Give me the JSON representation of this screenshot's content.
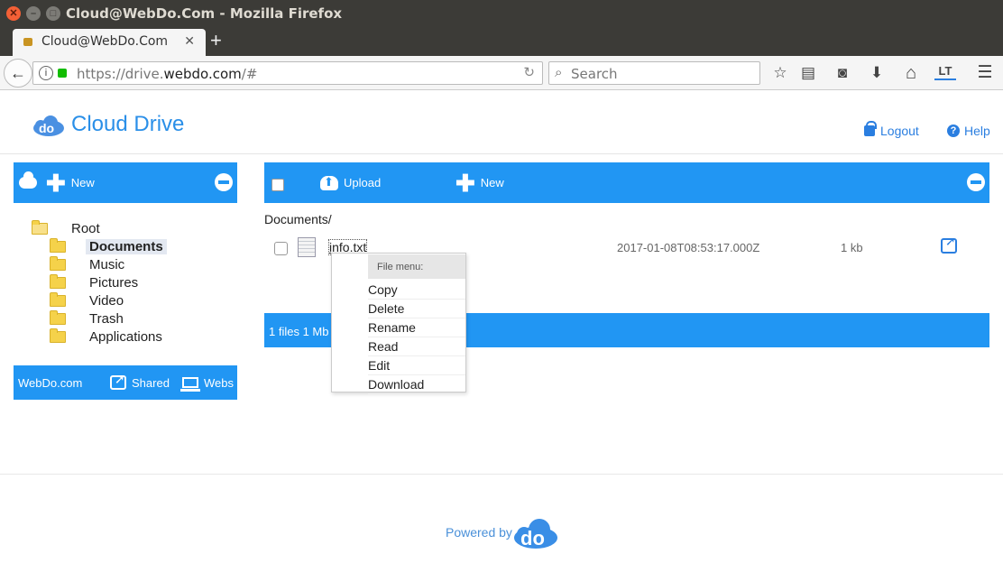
{
  "window": {
    "title": "Cloud@WebDo.Com - Mozilla Firefox",
    "close_glyph": "✕",
    "min_glyph": "–",
    "max_glyph": "□"
  },
  "tab": {
    "title": "Cloud@WebDo.Com",
    "close_glyph": "✕",
    "new_tab_glyph": "+"
  },
  "navbar": {
    "back_glyph": "←",
    "url_prefix": "https://drive.",
    "url_domain": "webdo.com",
    "url_suffix": "/#",
    "reload_glyph": "↻",
    "search_placeholder": "Search",
    "search_glyph": "⌕",
    "toolbar_icons": [
      "star-icon",
      "reading-list-icon",
      "pocket-icon",
      "download-icon",
      "home-icon",
      "languagetool-icon",
      "menu-icon"
    ],
    "star_glyph": "☆",
    "reader_glyph": "▤",
    "pocket_glyph": "◙",
    "download_glyph": "⬇",
    "home_glyph": "⌂",
    "lt_label": "LT",
    "menu_glyph": "☰"
  },
  "header": {
    "brand": "Cloud Drive",
    "logout": "Logout",
    "help": "Help",
    "help_glyph": "?",
    "brand_color": "#2a8fe8"
  },
  "left_panel": {
    "new_label": "New",
    "plus_glyph": "✚",
    "tree": [
      {
        "label": "Root",
        "level": 0,
        "open": true,
        "selected": false
      },
      {
        "label": "Documents",
        "level": 1,
        "open": false,
        "selected": true
      },
      {
        "label": "Music",
        "level": 1,
        "open": false,
        "selected": false
      },
      {
        "label": "Pictures",
        "level": 1,
        "open": false,
        "selected": false
      },
      {
        "label": "Video",
        "level": 1,
        "open": false,
        "selected": false
      },
      {
        "label": "Trash",
        "level": 1,
        "open": false,
        "selected": false
      },
      {
        "label": "Applications",
        "level": 1,
        "open": false,
        "selected": false
      }
    ],
    "footer": {
      "site": "WebDo.com",
      "shared": "Shared",
      "webs": "Webs"
    }
  },
  "main": {
    "upload_label": "Upload",
    "new_label": "New",
    "plus_glyph": "✚",
    "breadcrumb": "Documents/",
    "files": [
      {
        "name": "info.txt",
        "date": "2017-01-08T08:53:17.000Z",
        "size": "1 kb"
      }
    ],
    "status": "1 files 1 Mb"
  },
  "context_menu": {
    "header": "File menu:",
    "items": [
      "Copy",
      "Delete",
      "Rename",
      "Read",
      "Edit",
      "Download"
    ]
  },
  "footer": {
    "powered_by": "Powered by",
    "logo_text": "do"
  },
  "colors": {
    "accent": "#2196f3",
    "link": "#2a7ee0",
    "titlebar": "#3c3b37"
  }
}
